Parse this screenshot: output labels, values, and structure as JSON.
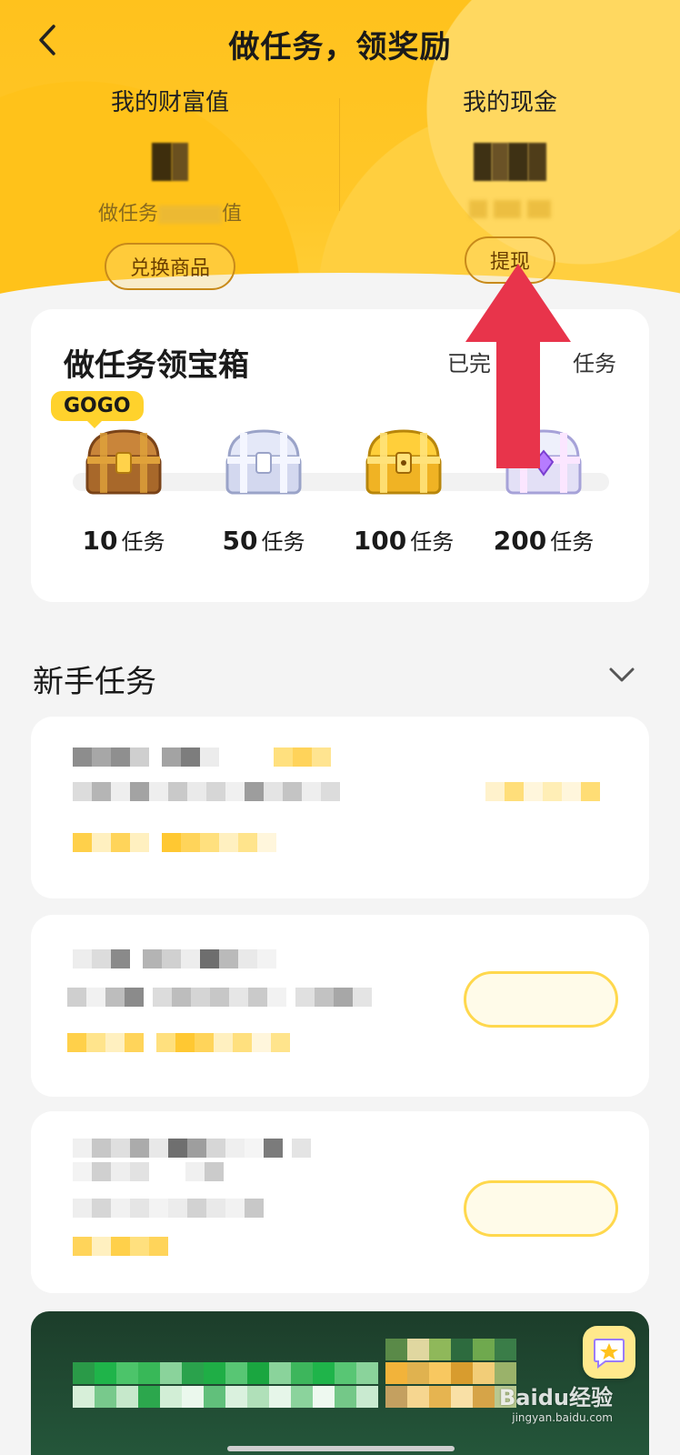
{
  "header": {
    "title": "做任务，领奖励",
    "wealth": {
      "label": "我的财富值",
      "sub_prefix": "做任务",
      "sub_suffix": "值",
      "button": "兑换商品"
    },
    "cash": {
      "label": "我的现金",
      "button": "提现"
    }
  },
  "chest_card": {
    "title": "做任务领宝箱",
    "progress_prefix": "已完",
    "progress_suffix": "任务",
    "badge": "GOGO",
    "chests": [
      {
        "count": "10",
        "unit": "任务",
        "kind": "wood"
      },
      {
        "count": "50",
        "unit": "任务",
        "kind": "silver"
      },
      {
        "count": "100",
        "unit": "任务",
        "kind": "gold"
      },
      {
        "count": "200",
        "unit": "任务",
        "kind": "diamond"
      }
    ]
  },
  "newbie": {
    "title": "新手任务"
  },
  "watermark": {
    "brand": "Baidu经验",
    "url": "jingyan.baidu.com"
  },
  "colors": {
    "brand_yellow": "#FFC21D",
    "annotation_red": "#E8344B",
    "card_bg": "#FFFFFF",
    "page_bg": "#F4F4F4"
  },
  "icons": [
    "back-icon",
    "chevron-down-icon",
    "chest-icon",
    "chat-star-icon"
  ]
}
